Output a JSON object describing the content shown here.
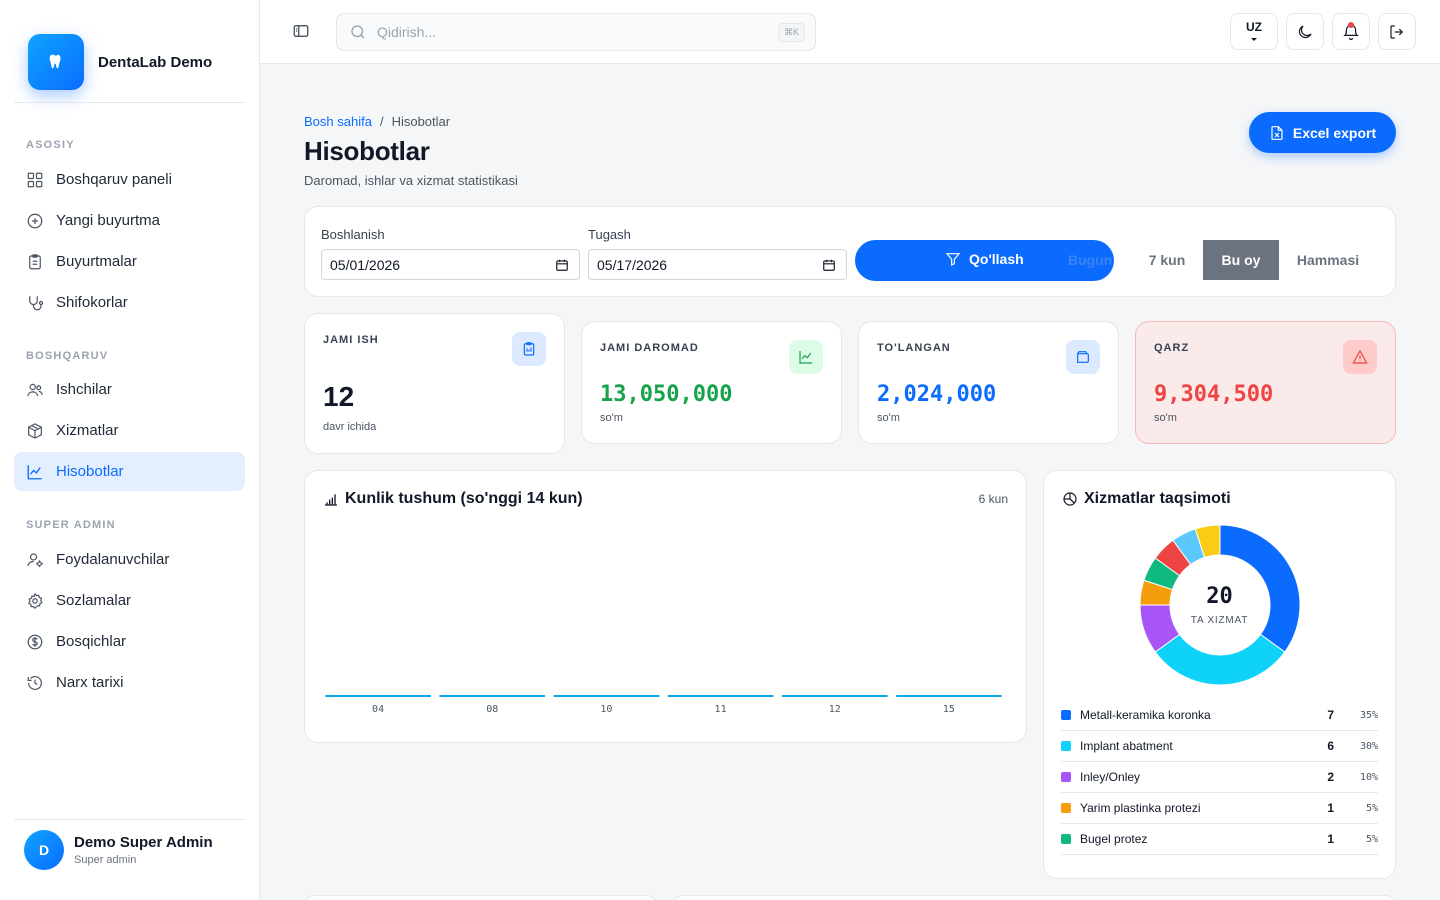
{
  "brand": {
    "name": "DentaLab Demo"
  },
  "sidebar": {
    "sections": [
      {
        "title": "ASOSIY"
      },
      {
        "title": "BOSHQARUV"
      },
      {
        "title": "SUPER ADMIN"
      }
    ],
    "items": [
      {
        "label": "Boshqaruv paneli",
        "icon": "dashboard-icon"
      },
      {
        "label": "Yangi buyurtma",
        "icon": "plus-circle-icon"
      },
      {
        "label": "Buyurtmalar",
        "icon": "clipboard-icon"
      },
      {
        "label": "Shifokorlar",
        "icon": "stethoscope-icon"
      },
      {
        "label": "Ishchilar",
        "icon": "users-icon"
      },
      {
        "label": "Xizmatlar",
        "icon": "package-icon"
      },
      {
        "label": "Hisobotlar",
        "icon": "chart-line-icon",
        "active": true
      },
      {
        "label": "Foydalanuvchilar",
        "icon": "user-cog-icon"
      },
      {
        "label": "Sozlamalar",
        "icon": "gear-icon"
      },
      {
        "label": "Bosqichlar",
        "icon": "dollar-circle-icon"
      },
      {
        "label": "Narx tarixi",
        "icon": "history-icon"
      }
    ]
  },
  "user": {
    "initial": "D",
    "name": "Demo Super Admin",
    "role": "Super admin"
  },
  "topbar": {
    "search_placeholder": "Qidirish...",
    "shortcut": "⌘K",
    "language": "UZ"
  },
  "header": {
    "breadcrumb": [
      "Bosh sahifa",
      "Hisobotlar"
    ],
    "breadcrumb_separator": "/",
    "title": "Hisobotlar",
    "subtitle": "Daromad, ishlar va xizmat statistikasi",
    "export_label": "Excel export"
  },
  "filter": {
    "start_label": "Boshlanish",
    "start_value": "05/01/2026",
    "end_label": "Tugash",
    "end_value": "05/17/2026",
    "apply_label": "Qo'llash",
    "ranges": [
      "Bugun",
      "7 kun",
      "Bu oy",
      "Hammasi"
    ],
    "active_range": "Bu oy"
  },
  "stats": [
    {
      "label": "JAMI ISH",
      "value": "12",
      "sub": "davr ichida",
      "color": "#111827",
      "icon": "clipboard-icon"
    },
    {
      "label": "JAMI DAROMAD",
      "value": "13,050,000",
      "sub": "so'm",
      "color": "#16a34a",
      "icon": "chart-line-icon"
    },
    {
      "label": "TO'LANGAN",
      "value": "2,024,000",
      "sub": "so'm",
      "color": "#0b6bff",
      "icon": "wallet-icon"
    },
    {
      "label": "QARZ",
      "value": "9,304,500",
      "sub": "so'm",
      "color": "#ef4444",
      "icon": "alert-triangle-icon"
    }
  ],
  "daily_chart": {
    "title": "Kunlik tushum (so'nggi 14 kun)",
    "meta": "6 kun"
  },
  "chart_data": {
    "type": "bar",
    "categories": [
      "04",
      "08",
      "10",
      "11",
      "12",
      "15"
    ],
    "values": [
      0,
      0,
      0,
      0,
      0,
      0
    ],
    "title": "Kunlik tushum (so'nggi 14 kun)",
    "xlabel": "",
    "ylabel": "",
    "color": "#0ea5e9"
  },
  "services": {
    "title": "Xizmatlar taqsimoti",
    "total": "20",
    "total_label": "TA XIZMAT",
    "slices": [
      {
        "name": "Metall-keramika koronka",
        "count": 7,
        "pct": "35%",
        "color": "#0b6bff"
      },
      {
        "name": "Implant abatment",
        "count": 6,
        "pct": "30%",
        "color": "#0ed2f7"
      },
      {
        "name": "Inley/Onley",
        "count": 2,
        "pct": "10%",
        "color": "#a855f7"
      },
      {
        "name": "Yarim plastinka protezi",
        "count": 1,
        "pct": "5%",
        "color": "#f59e0b"
      },
      {
        "name": "Bugel protez",
        "count": 1,
        "pct": "5%",
        "color": "#10b981"
      },
      {
        "count": 1,
        "color": "#ef4444"
      },
      {
        "count": 1,
        "color": "#5ac8fa"
      },
      {
        "count": 1,
        "color": "#facc15"
      }
    ]
  }
}
